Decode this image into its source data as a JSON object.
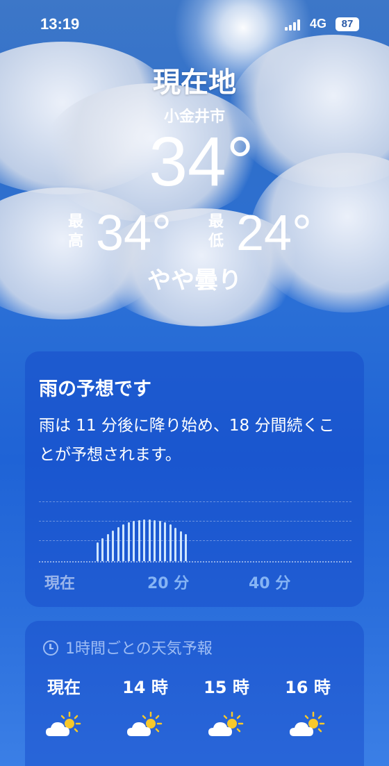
{
  "status_bar": {
    "time": "13:19",
    "network": "4G",
    "battery": "87"
  },
  "location_title": "現在地",
  "city": "小金井市",
  "current_temp": "34°",
  "high": {
    "label": "最高",
    "value": "34°"
  },
  "low": {
    "label": "最低",
    "value": "24°"
  },
  "condition": "やや曇り",
  "rain_card": {
    "title": "雨の予想です",
    "description": "雨は 11 分後に降り始め、18 分間続くことが予想されます。",
    "x_ticks": [
      "現在",
      "20 分",
      "40 分"
    ]
  },
  "chart_data": {
    "type": "bar",
    "x": [
      11,
      12,
      13,
      14,
      15,
      16,
      17,
      18,
      19,
      20,
      21,
      22,
      23,
      24,
      25,
      26,
      27,
      28
    ],
    "values": [
      0.45,
      0.55,
      0.65,
      0.74,
      0.82,
      0.88,
      0.93,
      0.96,
      0.98,
      1.0,
      1.0,
      0.98,
      0.96,
      0.93,
      0.88,
      0.8,
      0.72,
      0.65
    ],
    "xlabel": "",
    "ylabel": "",
    "xlim": [
      0,
      60
    ],
    "ylim": [
      0,
      1
    ]
  },
  "hourly_card": {
    "title": "1時間ごとの天気予報",
    "hours": [
      {
        "label": "現在",
        "icon": "partly-cloudy-sun-icon"
      },
      {
        "label": "14 時",
        "icon": "partly-cloudy-sun-icon"
      },
      {
        "label": "15 時",
        "icon": "partly-cloudy-sun-icon"
      },
      {
        "label": "16 時",
        "icon": "partly-cloudy-sun-icon"
      }
    ]
  }
}
